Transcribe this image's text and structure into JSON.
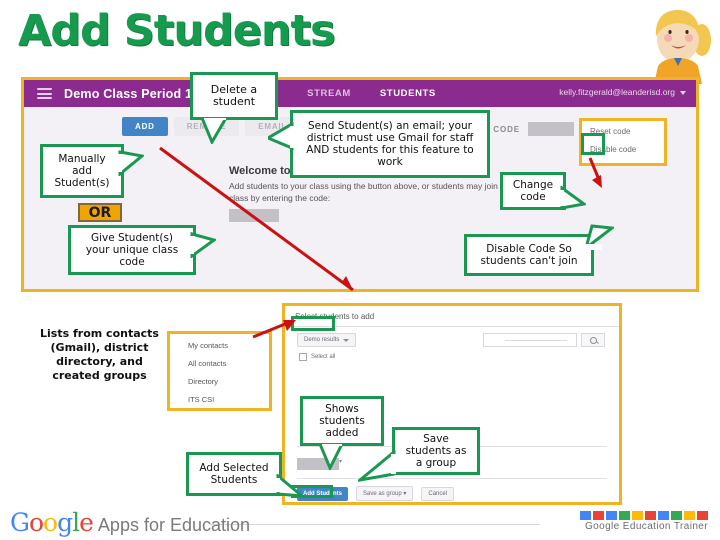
{
  "page": {
    "title": "Add Students"
  },
  "classroom": {
    "menu_icon": "hamburger-icon",
    "class_name": "Demo Class Period 1",
    "tabs": [
      {
        "label": "STREAM",
        "active": false
      },
      {
        "label": "STUDENTS",
        "active": true
      }
    ],
    "user_email": "kelly.fitzgerald@leanderisd.org",
    "buttons": {
      "add": "ADD",
      "remove": "REMOVE",
      "email": "EMAIL"
    },
    "class_code": {
      "label": "CLASS CODE",
      "value": "",
      "dropdown_icon": "chevron-down-icon"
    },
    "roster": {
      "heading": "Welcome to your class roster!",
      "body": "Add students to your class using the button above, or students may join the class by entering the code:",
      "code_value": ""
    },
    "code_menu": [
      {
        "label": "Reset code"
      },
      {
        "label": "Disable code"
      }
    ]
  },
  "contacts_menu": {
    "items": [
      {
        "label": "My contacts"
      },
      {
        "label": "All contacts"
      },
      {
        "label": "Directory"
      },
      {
        "label": "ITS CSI"
      }
    ]
  },
  "add_dialog": {
    "title": "Select students to add",
    "scope_button": "Demo results",
    "scope_icon": "chevron-down-icon",
    "select_all": "Select all",
    "search_placeholder": "",
    "search_icon": "search-icon",
    "selected_value": "",
    "buttons": {
      "add_students": "Add Students",
      "save_as_group": "Save as group",
      "cancel": "Cancel"
    }
  },
  "callouts": {
    "delete_student": "Delete a\nstudent",
    "send_email": "Send Student(s) an email; your district must use Gmail for staff AND students for this feature to work",
    "manual_add": "Manually\nadd\nStudent(s)",
    "or_badge": "OR",
    "give_code": "Give Student(s)\nyour unique class\ncode",
    "change_code": "Change\ncode",
    "disable_code": "Disable Code So\nstudents can't join",
    "lists_from_contacts": "Lists from contacts\n(Gmail), district\ndirectory, and\ncreated groups",
    "shows_students_added": "Shows\nstudents\nadded",
    "add_selected": "Add Selected\nStudents",
    "save_as_group": "Save\nstudents as\na group"
  },
  "footer": {
    "google_letters": [
      "G",
      "o",
      "o",
      "g",
      "l",
      "e"
    ],
    "google_colors": [
      "#4285F4",
      "#EA4335",
      "#FBBC05",
      "#4285F4",
      "#34A853",
      "#EA4335"
    ],
    "apps_for_education": "Apps for Education",
    "trainer_label": "Google Education Trainer",
    "badge_colors": [
      "#4285F4",
      "#EA4335",
      "#4285F4",
      "#34A853",
      "#FBBC05",
      "#EA4335",
      "#4285F4",
      "#34A853",
      "#FBBC05",
      "#EA4335"
    ]
  },
  "theme": {
    "title_green": "#169b4e",
    "callout_green": "#1a9751",
    "yellow": "#f0b323",
    "purple": "#8c2b8f",
    "arrow_red": "#cc1111",
    "blue": "#4285c6"
  }
}
